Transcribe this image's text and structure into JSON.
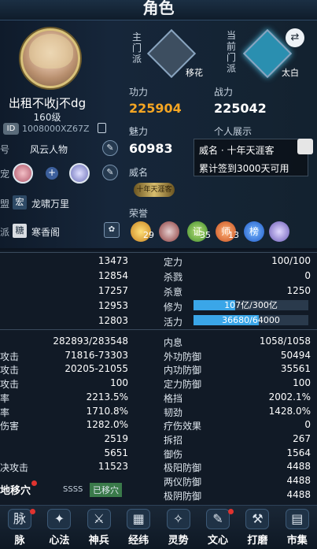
{
  "window": {
    "title": "角色"
  },
  "profile": {
    "name": "出租不收j不dg",
    "level": "160级",
    "id_tag": "ID",
    "id_value": "1008000XZ67Z",
    "rows": [
      {
        "label": "号",
        "value": "风云人物"
      },
      {
        "label": "宠",
        "value": ""
      },
      {
        "label": "盟",
        "badge": "宏",
        "value": "龙啸万里"
      },
      {
        "label": "派",
        "badge": "糖",
        "value": "寒香阁"
      }
    ]
  },
  "school": {
    "main_label": "主门派",
    "main_name": "移花",
    "current_label": "当前门派",
    "current_name": "太白"
  },
  "power": {
    "gongli_label": "功力",
    "gongli_value": "225904",
    "zhanli_label": "战力",
    "zhanli_value": "225042",
    "meili_label": "魅力",
    "meili_value": "60983",
    "showcase_label": "个人展示",
    "weiming_label": "威名",
    "weiming_badge": "十年天涯客",
    "honor_label": "荣誉",
    "honor_counts": [
      "29",
      "",
      "35",
      "13",
      "",
      ""
    ],
    "honor_glyphs": [
      "誉",
      "",
      "证",
      "师",
      "榜",
      ""
    ]
  },
  "tooltip": {
    "line1": "威名 · 十年天涯客",
    "line2": "累计签到3000天可用"
  },
  "stats_top": [
    {
      "l1": "",
      "v1": "13473",
      "l2": "定力",
      "v2": "100/100"
    },
    {
      "l1": "",
      "v1": "12854",
      "l2": "杀戮",
      "v2": "0"
    },
    {
      "l1": "",
      "v1": "17257",
      "l2": "杀意",
      "v2": "1250"
    },
    {
      "l1": "",
      "v1": "12953",
      "l2": "修为",
      "bar": "107亿/300亿",
      "fill": 0.36
    },
    {
      "l1": "",
      "v1": "12803",
      "l2": "活力",
      "bar": "36680/64000",
      "fill": 0.57
    }
  ],
  "stats_main": [
    {
      "l1": "",
      "v1": "282893/283548",
      "l2": "内息",
      "v2": "1058/1058"
    },
    {
      "l1": "攻击",
      "v1": "71816-73303",
      "l2": "外功防御",
      "v2": "50494"
    },
    {
      "l1": "攻击",
      "v1": "20205-21055",
      "l2": "内功防御",
      "v2": "35561"
    },
    {
      "l1": "攻击",
      "v1": "100",
      "l2": "定力防御",
      "v2": "100"
    },
    {
      "l1": "率",
      "v1": "2213.5%",
      "l2": "格挡",
      "v2": "2002.1%"
    },
    {
      "l1": "率",
      "v1": "1710.8%",
      "l2": "韧劲",
      "v2": "1428.0%"
    },
    {
      "l1": "伤害",
      "v1": "1282.0%",
      "l2": "疗伤效果",
      "v2": "0"
    },
    {
      "l1": "",
      "v1": "2519",
      "l2": "拆招",
      "v2": "267"
    },
    {
      "l1": "",
      "v1": "5651",
      "l2": "御伤",
      "v2": "1564"
    },
    {
      "l1": "决攻击",
      "v1": "11523",
      "l2": "极阳防御",
      "v2": "4488"
    },
    {
      "l1": "",
      "v1": "",
      "l2": "两仪防御",
      "v2": "4488"
    },
    {
      "l1": "",
      "v1": "",
      "l2": "极阴防御",
      "v2": "4488"
    }
  ],
  "acupoint": {
    "label": "地移穴",
    "grade": "SSSS",
    "status": "已移穴"
  },
  "bottom_nav": [
    {
      "label": "脉",
      "icon": "meridian-icon",
      "glyph": "脉"
    },
    {
      "label": "心法",
      "icon": "mind-skill-icon",
      "glyph": "✦"
    },
    {
      "label": "神兵",
      "icon": "weapon-icon",
      "glyph": "⚔"
    },
    {
      "label": "经纬",
      "icon": "grid-icon",
      "glyph": "▦"
    },
    {
      "label": "灵势",
      "icon": "spirit-icon",
      "glyph": "✧"
    },
    {
      "label": "文心",
      "icon": "brush-icon",
      "glyph": "✎"
    },
    {
      "label": "打磨",
      "icon": "hammer-icon",
      "glyph": "⚒"
    },
    {
      "label": "市集",
      "icon": "market-icon",
      "glyph": "▤"
    }
  ],
  "colors": {
    "gongli": "#f5a623",
    "accent_bar": "#3aa6e8",
    "acupoint_status_bg": "#3a7a4a"
  }
}
